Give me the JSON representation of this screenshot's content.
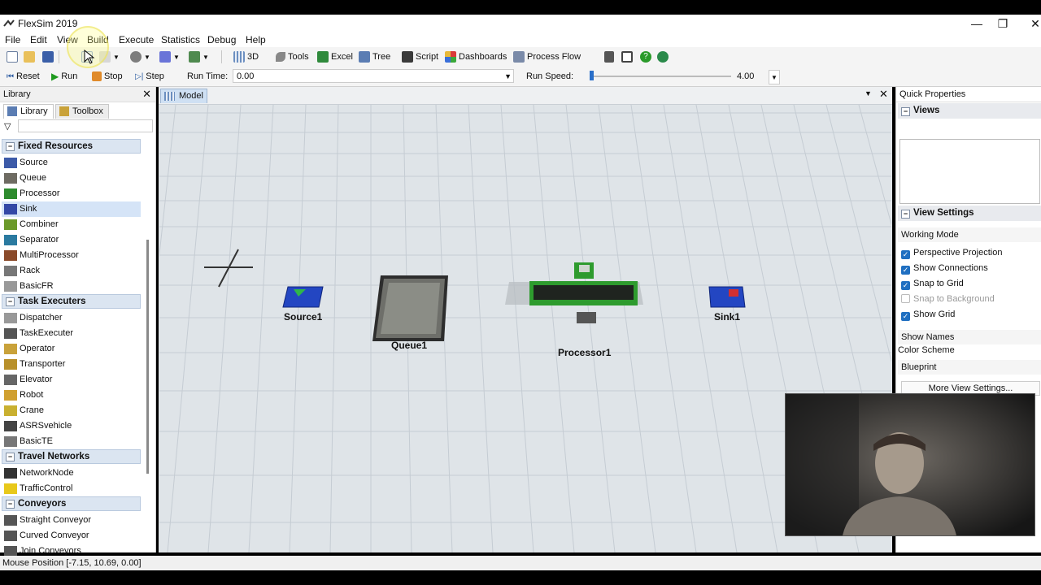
{
  "app": {
    "title": "FlexSim 2019",
    "icon": "flexsim-logo-icon"
  },
  "window_controls": [
    "minimize",
    "restore",
    "close"
  ],
  "menu": [
    "File",
    "Edit",
    "View",
    "Build",
    "Execute",
    "Statistics",
    "Debug",
    "Help"
  ],
  "toolbar": {
    "view3d_label": "3D",
    "tools_label": "Tools",
    "excel_label": "Excel",
    "tree_label": "Tree",
    "script_label": "Script",
    "dashboards_label": "Dashboards",
    "processflow_label": "Process Flow"
  },
  "run_controls": {
    "reset_label": "Reset",
    "run_label": "Run",
    "stop_label": "Stop",
    "step_label": "Step",
    "run_time_label": "Run Time:",
    "run_time_value": "0.00",
    "run_speed_label": "Run Speed:",
    "run_speed_value": "4.00"
  },
  "library": {
    "title": "Library",
    "tabs": [
      "Library",
      "Toolbox"
    ],
    "filter_value": "",
    "categories": [
      {
        "name": "Fixed Resources",
        "items": [
          "Source",
          "Queue",
          "Processor",
          "Sink",
          "Combiner",
          "Separator",
          "MultiProcessor",
          "Rack",
          "BasicFR"
        ]
      },
      {
        "name": "Task Executers",
        "items": [
          "Dispatcher",
          "TaskExecuter",
          "Operator",
          "Transporter",
          "Elevator",
          "Robot",
          "Crane",
          "ASRSvehicle",
          "BasicTE"
        ]
      },
      {
        "name": "Travel Networks",
        "items": [
          "NetworkNode",
          "TrafficControl"
        ]
      },
      {
        "name": "Conveyors",
        "items": [
          "Straight Conveyor",
          "Curved Conveyor",
          "Join Conveyors"
        ]
      }
    ],
    "selected_item": "Sink"
  },
  "model": {
    "tab_label": "Model",
    "objects": [
      {
        "name": "Source1",
        "type": "Source"
      },
      {
        "name": "Queue1",
        "type": "Queue"
      },
      {
        "name": "Processor1",
        "type": "Processor"
      },
      {
        "name": "Sink1",
        "type": "Sink"
      }
    ]
  },
  "quick_properties": {
    "title": "Quick Properties",
    "views_label": "Views",
    "view_settings_label": "View Settings",
    "working_mode_label": "Working Mode",
    "checkboxes": [
      {
        "label": "Perspective Projection",
        "checked": true
      },
      {
        "label": "Show Connections",
        "checked": true
      },
      {
        "label": "Snap to Grid",
        "checked": true
      },
      {
        "label": "Snap to Background",
        "checked": false
      },
      {
        "label": "Show Grid",
        "checked": true
      }
    ],
    "show_names_label": "Show Names",
    "color_scheme_label": "Color Scheme",
    "color_scheme_value": "Blueprint",
    "more_settings_label": "More View Settings..."
  },
  "status": {
    "mouse_position": "Mouse Position [-7.15, 10.69, 0.00]"
  },
  "colors": {
    "accent": "#1f6fc1",
    "grid_bg": "#dfe4e8",
    "category_bg": "#dbe5f1",
    "processor_green": "#2e9b2e"
  }
}
